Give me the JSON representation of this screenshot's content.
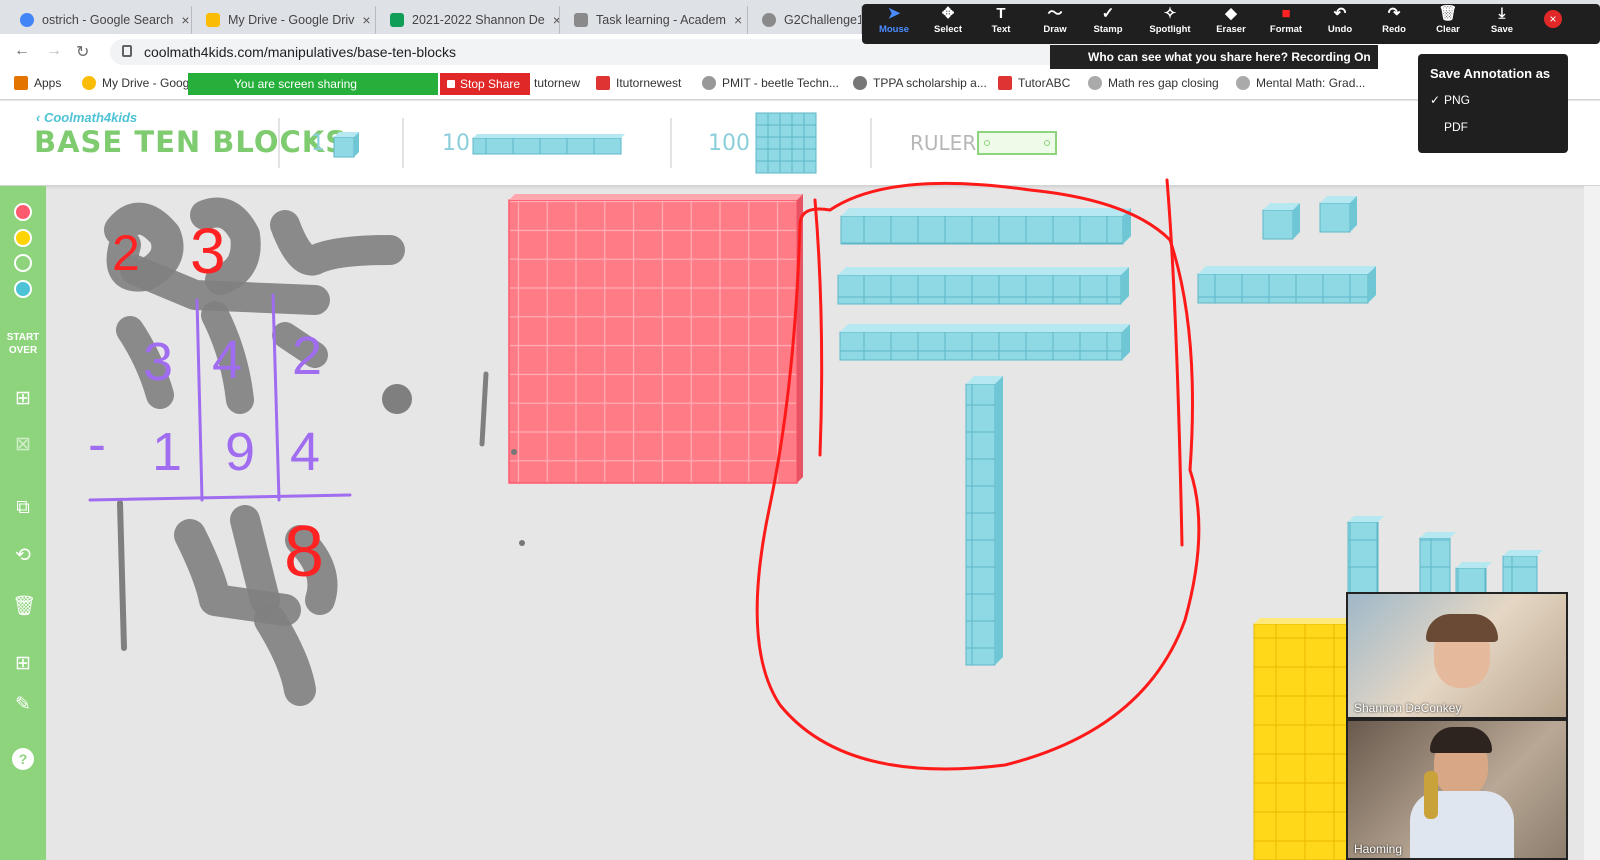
{
  "browser": {
    "tabs": [
      {
        "label": "ostrich - Google Search",
        "color": "#4285f4"
      },
      {
        "label": "My Drive - Google Driv",
        "color": "#fbbc05"
      },
      {
        "label": "2021-2022 Shannon De",
        "color": "#0f9d58"
      },
      {
        "label": "Task learning - Academ",
        "color": "#8a8a8a"
      },
      {
        "label": "G2Challenge1",
        "color": "#8a8a8a"
      }
    ],
    "url": "coolmath4kids.com/manipulatives/base-ten-blocks"
  },
  "bookmarks": {
    "items": [
      "Apps",
      "My Drive - Goog",
      "tutornew",
      "Itutornewest",
      "PMIT - beetle Techn...",
      "TPPA scholarship a...",
      "TutorABC",
      "Math res gap closing",
      "Mental Math: Grad..."
    ],
    "sharing_label": "You are screen sharing",
    "stop_label": "Stop Share"
  },
  "zoom_toolbar": {
    "buttons": [
      "Mouse",
      "Select",
      "Text",
      "Draw",
      "Stamp",
      "Spotlight",
      "Eraser",
      "Format",
      "Undo",
      "Redo",
      "Clear",
      "Save"
    ],
    "active": "Mouse",
    "notice": "Who can see what you share here? Recording On",
    "save_menu": {
      "title": "Save Annotation as",
      "options": [
        "PNG",
        "PDF"
      ],
      "selected": "PNG"
    }
  },
  "app": {
    "logo": "Coolmath4kids",
    "title": "BASE TEN BLOCKS",
    "blocks": [
      {
        "value": "1"
      },
      {
        "value": "10"
      },
      {
        "value": "100"
      }
    ],
    "ruler_label": "RULER",
    "start_over": "START OVER",
    "colors": [
      "#ff5a6e",
      "#ffd400",
      "#8ed47d",
      "#4ec3d6"
    ]
  },
  "annotations": {
    "handwriting": [
      "2",
      "3",
      "3",
      "4",
      "2",
      "-",
      "1",
      "9",
      "4",
      "8"
    ]
  },
  "participants": [
    {
      "name": "Shannon DeConkey"
    },
    {
      "name": "Haoming"
    }
  ]
}
